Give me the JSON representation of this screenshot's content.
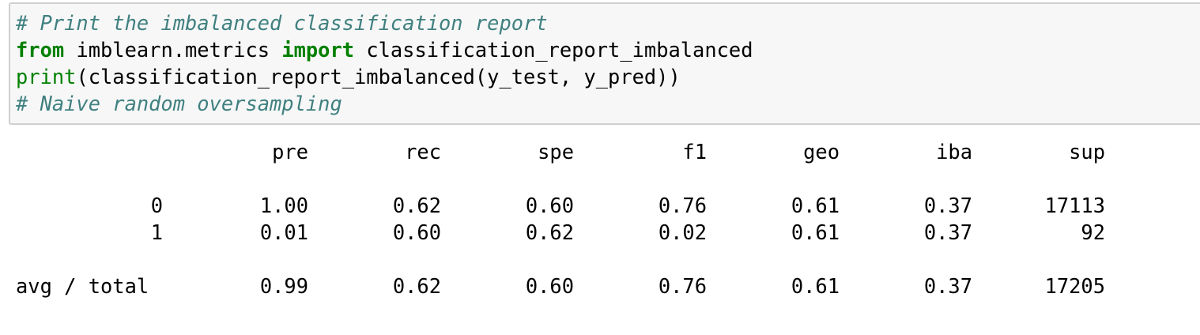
{
  "code_cell": {
    "line1_comment": "# Print the imbalanced classification report",
    "line2_from": "from",
    "line2_module": " imblearn.metrics ",
    "line2_import": "import",
    "line2_name": " classification_report_imbalanced",
    "line3_print": "print",
    "line3_rest": "(classification_report_imbalanced(y_test, y_pred))",
    "line4_comment": "# Naive random oversampling"
  },
  "report": {
    "headers": [
      "pre",
      "rec",
      "spe",
      "f1",
      "geo",
      "iba",
      "sup"
    ],
    "rows": [
      {
        "label": "0",
        "values": [
          "1.00",
          "0.62",
          "0.60",
          "0.76",
          "0.61",
          "0.37",
          "17113"
        ]
      },
      {
        "label": "1",
        "values": [
          "0.01",
          "0.60",
          "0.62",
          "0.02",
          "0.61",
          "0.37",
          "92"
        ]
      }
    ],
    "total": {
      "label": "avg / total",
      "values": [
        "0.99",
        "0.62",
        "0.60",
        "0.76",
        "0.61",
        "0.37",
        "17205"
      ]
    }
  },
  "colors": {
    "comment": "#408080",
    "keyword": "#008000",
    "cell_background": "#f7f7f7",
    "cell_border": "#cfcfcf"
  }
}
